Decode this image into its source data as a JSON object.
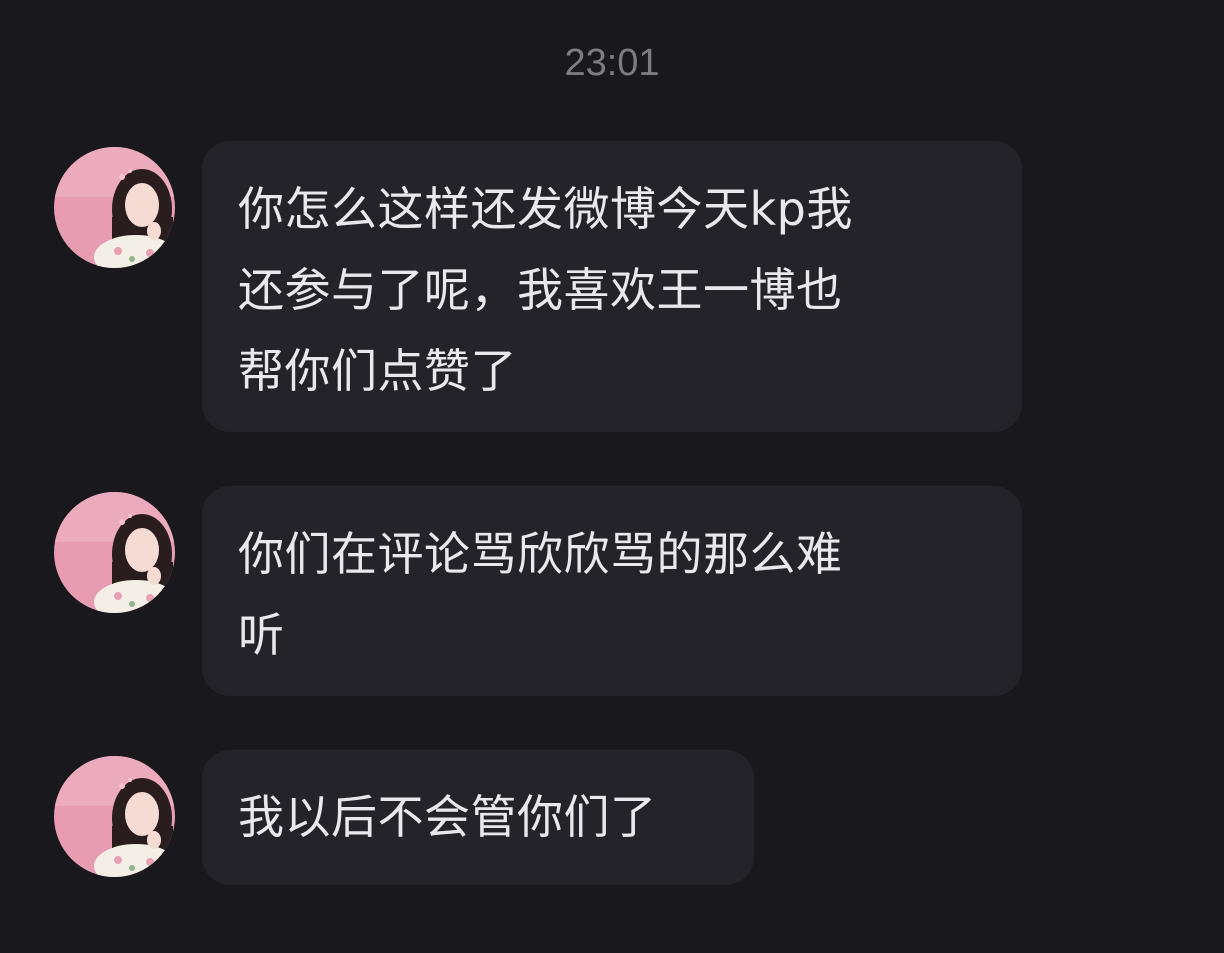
{
  "chat": {
    "timestamp": "23:01",
    "messages": [
      {
        "avatar_icon": "user-avatar-icon",
        "lines": [
          "你怎么这样还发微博今天kp我",
          "还参与了呢，我喜欢王一博也",
          "帮你们点赞了"
        ]
      },
      {
        "avatar_icon": "user-avatar-icon",
        "lines": [
          "你们在评论骂欣欣骂的那么难",
          "听"
        ]
      },
      {
        "avatar_icon": "user-avatar-icon",
        "lines": [
          "我以后不会管你们了"
        ]
      }
    ]
  },
  "colors": {
    "background": "#19181d",
    "bubble": "#242329",
    "text": "#e9e8ec",
    "timestamp": "#7d7c83",
    "avatar_bg": "#e79cb2"
  }
}
